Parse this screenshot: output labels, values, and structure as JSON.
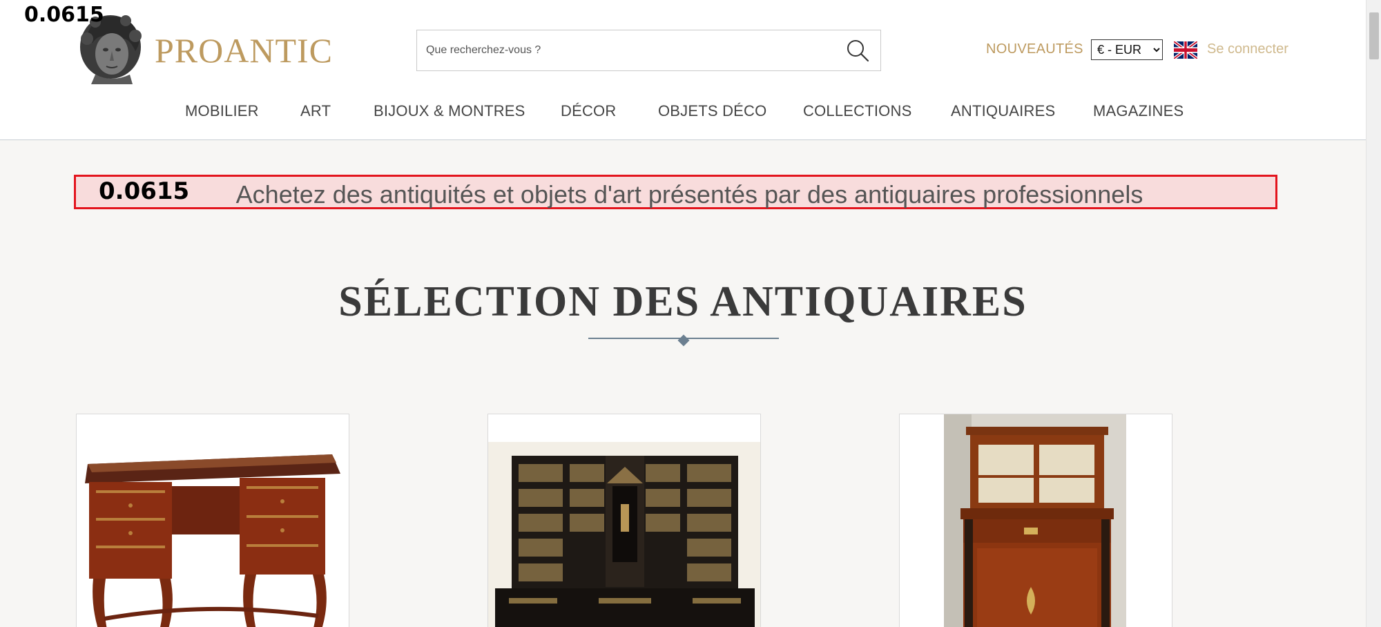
{
  "debug": {
    "top_label": "0.0615",
    "banner_label": "0.0615"
  },
  "header": {
    "logo_text": "PROANTIC",
    "search": {
      "placeholder": "Que recherchez-vous ?",
      "value": ""
    },
    "nouveautes": "NOUVEAUTÉS",
    "currency": {
      "selected": "€ - EUR"
    },
    "login": "Se connecter",
    "flag": "uk-flag-icon"
  },
  "nav": {
    "items": [
      {
        "label": "MOBILIER"
      },
      {
        "label": "ART"
      },
      {
        "label": "BIJOUX & MONTRES"
      },
      {
        "label": "DÉCOR"
      },
      {
        "label": "OBJETS DÉCO"
      },
      {
        "label": "COLLECTIONS"
      },
      {
        "label": "ANTIQUAIRES"
      },
      {
        "label": "MAGAZINES"
      }
    ]
  },
  "banner": {
    "text": "Achetez des antiquités et objets d'art présentés par des antiquaires professionnels"
  },
  "section": {
    "title": "SÉLECTION DES ANTIQUAIRES"
  },
  "colors": {
    "accent_gold": "#bd9a5f",
    "login_gold": "#cfb98d",
    "banner_bg": "#f8dcdc",
    "banner_border": "#e3141d",
    "page_bg": "#f7f6f4"
  }
}
